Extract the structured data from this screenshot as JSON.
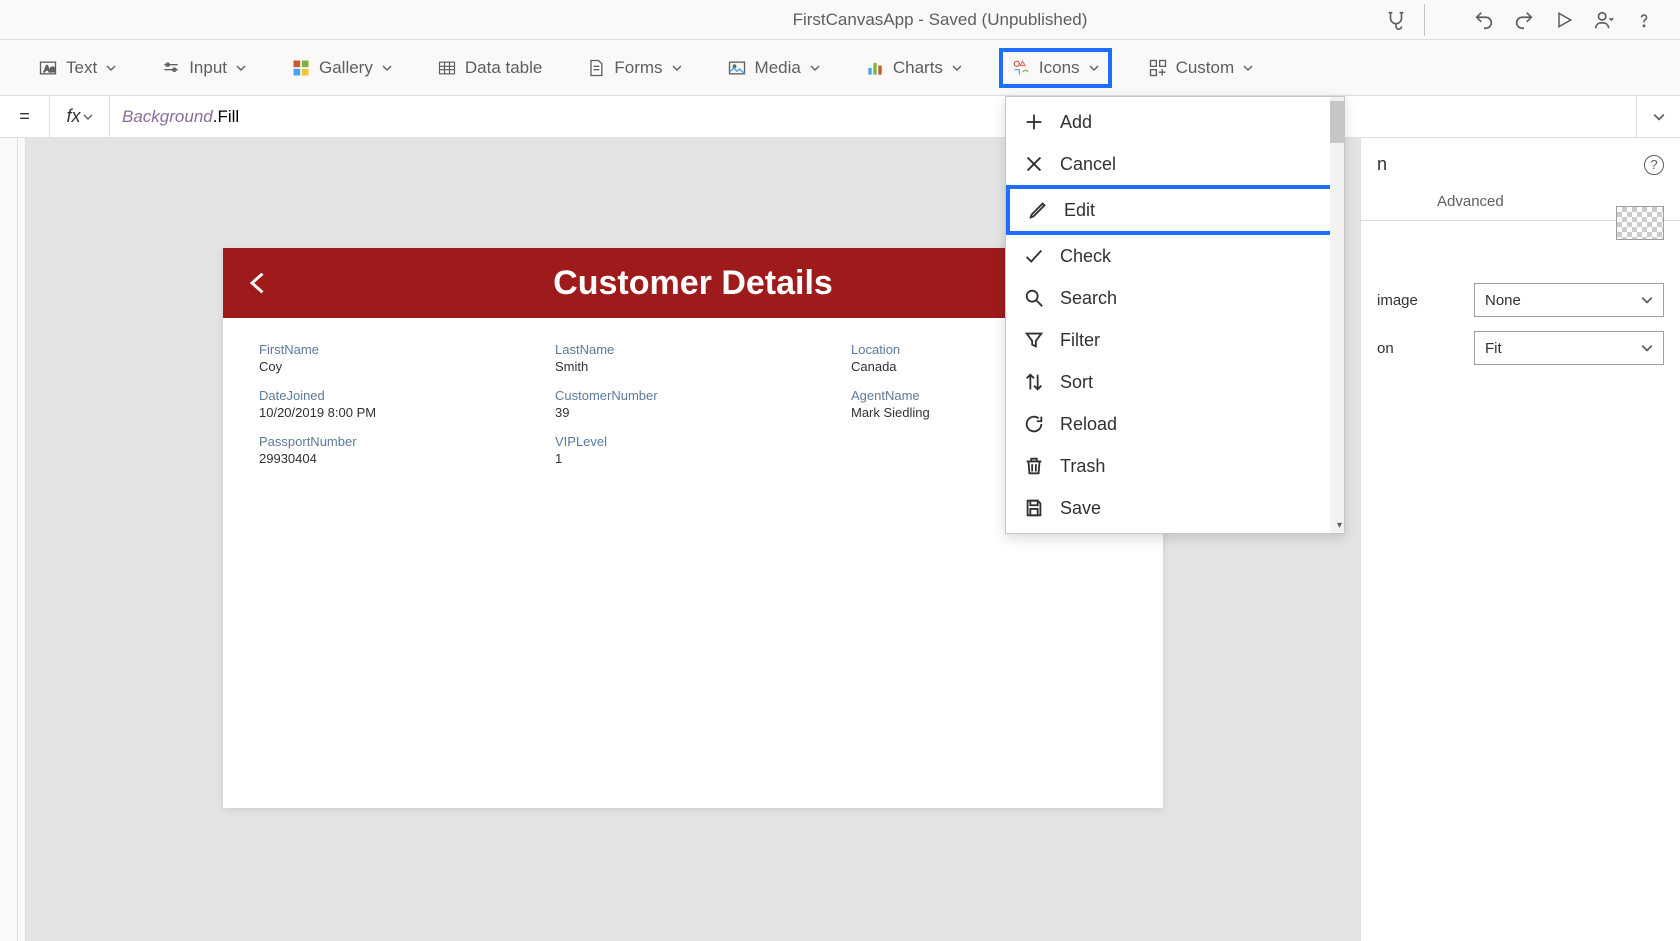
{
  "titlebar": {
    "title": "FirstCanvasApp - Saved (Unpublished)"
  },
  "ribbon": {
    "text": "Text",
    "input": "Input",
    "gallery": "Gallery",
    "datatable": "Data table",
    "forms": "Forms",
    "media": "Media",
    "charts": "Charts",
    "icons": "Icons",
    "custom": "Custom"
  },
  "formula": {
    "eq": "=",
    "fx": "fx",
    "object": "Background",
    "prop": ".Fill"
  },
  "canvas": {
    "title": "Customer Details",
    "fields": {
      "firstname_label": "FirstName",
      "firstname_value": "Coy",
      "lastname_label": "LastName",
      "lastname_value": "Smith",
      "location_label": "Location",
      "location_value": "Canada",
      "datejoined_label": "DateJoined",
      "datejoined_value": "10/20/2019 8:00 PM",
      "customernumber_label": "CustomerNumber",
      "customernumber_value": "39",
      "agentname_label": "AgentName",
      "agentname_value": "Mark Siedling",
      "passport_label": "PassportNumber",
      "passport_value": "29930404",
      "viplevel_label": "VIPLevel",
      "viplevel_value": "1"
    }
  },
  "dropdown": {
    "add": "Add",
    "cancel": "Cancel",
    "edit": "Edit",
    "check": "Check",
    "search": "Search",
    "filter": "Filter",
    "sort": "Sort",
    "reload": "Reload",
    "trash": "Trash",
    "save": "Save"
  },
  "rightpanel": {
    "title_suffix": "n",
    "tab_advanced": "Advanced",
    "prop_image": "image",
    "prop_image_value": "None",
    "prop_position": "on",
    "prop_position_value": "Fit"
  }
}
